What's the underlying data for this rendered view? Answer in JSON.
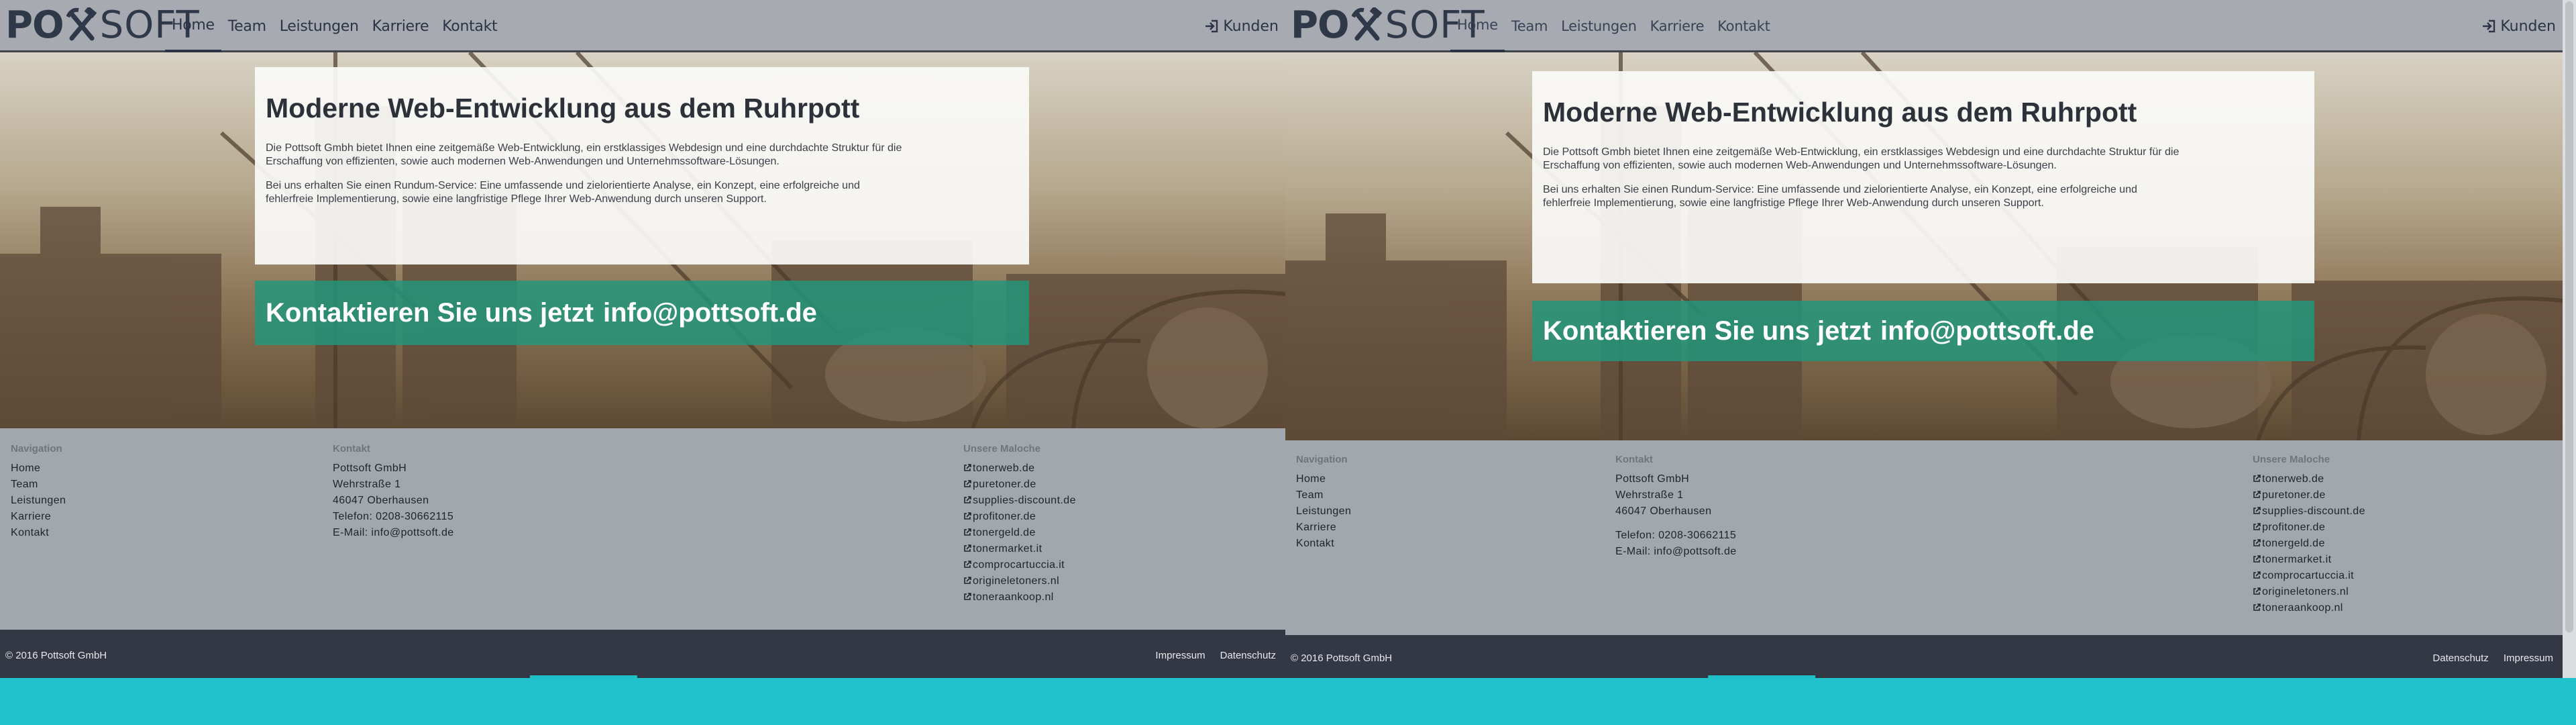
{
  "logo": {
    "left": "PO",
    "right": "SOFT"
  },
  "nav": {
    "items": [
      {
        "label": "Home",
        "active": true
      },
      {
        "label": "Team"
      },
      {
        "label": "Leistungen"
      },
      {
        "label": "Karriere"
      },
      {
        "label": "Kontakt"
      }
    ],
    "kunden_label": "Kunden"
  },
  "hero": {
    "title": "Moderne Web-Entwicklung aus dem Ruhrpott",
    "paragraph1": "Die Pottsoft Gmbh bietet Ihnen eine zeitgemäße Web-Entwicklung, ein erstklassiges Webdesign und eine durchdachte Struktur für die Erschaffung von effizienten, sowie auch modernen Web-Anwendungen und Unternehmssoftware-Lösungen.",
    "paragraph2": "Bei uns erhalten Sie einen Rundum-Service: Eine umfassende und zielorientierte Analyse, ein Konzept, eine erfolgreiche und fehlerfreie Implementierung, sowie eine langfristige Pflege Ihrer Web-Anwendung durch unseren Support.",
    "contact_text": "Kontaktieren Sie uns jetzt",
    "contact_email": "info@pottsoft.de"
  },
  "footer": {
    "navigation_heading": "Navigation",
    "navigation": [
      "Home",
      "Team",
      "Leistungen",
      "Karriere",
      "Kontakt"
    ],
    "contact_heading": "Kontakt",
    "company": "Pottsoft GmbH",
    "street": "Wehrstraße 1",
    "city": "46047 Oberhausen",
    "phone": "Telefon: 0208-30662115",
    "email": "E-Mail: info@pottsoft.de",
    "projects_heading": "Unsere Maloche",
    "projects": [
      "tonerweb.de",
      "puretoner.de",
      "supplies-discount.de",
      "profitoner.de",
      "tonergeld.de",
      "tonermarket.it",
      "comprocartuccia.it",
      "origineletoners.nl",
      "toneraankoop.nl"
    ]
  },
  "bottom": {
    "copyright": "© 2016 Pottsoft GmbH",
    "impressum": "Impressum",
    "datenschutz": "Datenschutz"
  },
  "colors": {
    "navbar": "#a7aab1",
    "footer": "#a2a6ad",
    "bottombar": "#333844",
    "contact_band": "#21967b",
    "page_background": "#22c2cc"
  }
}
